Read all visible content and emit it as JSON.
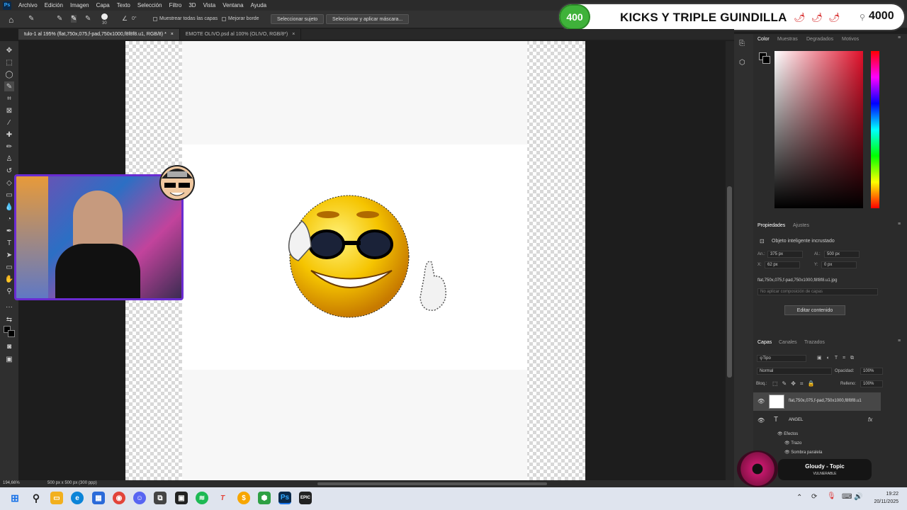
{
  "menu": [
    "Archivo",
    "Edición",
    "Imagen",
    "Capa",
    "Texto",
    "Selección",
    "Filtro",
    "3D",
    "Vista",
    "Ventana",
    "Ayuda"
  ],
  "options": {
    "brush_size": "30",
    "angle": "0°",
    "sample_all": "Muestrear todas las capas",
    "enhance_edge": "Mejorar borde",
    "select_subject": "Seleccionar sujeto",
    "select_mask": "Seleccionar y aplicar máscara..."
  },
  "tabs": [
    {
      "label": "tulo-1 al 195% (flat,750x,075,f-pad,750x1000,f8f8f8.u1, RGB/8) *",
      "close": "×"
    },
    {
      "label": "EMOTE OLIVO.psd al 100% (OLIVO, RGB/8*)",
      "close": "×"
    }
  ],
  "stream": {
    "left_count": "400",
    "title": "KICKS Y TRIPLE GUINDILLA",
    "right_count": "4000"
  },
  "color_panel": {
    "tabs": [
      "Color",
      "Muestras",
      "Degradados",
      "Motivos"
    ]
  },
  "properties": {
    "tabs": [
      "Propiedades",
      "Ajustes"
    ],
    "type": "Objeto inteligente incrustado",
    "w_label": "An.:",
    "w": "375 px",
    "h_label": "Al.:",
    "h": "500 px",
    "x_label": "X:",
    "x": "62 px",
    "y_label": "Y:",
    "y": "0 px",
    "filename": "flat,750x,075,f-pad,750x1000,f8f8f8.u1.jpg",
    "comp": "No aplicar composición de capas",
    "edit_button": "Editar contenido"
  },
  "layers": {
    "tabs": [
      "Capas",
      "Canales",
      "Trazados"
    ],
    "filter": "Tipo",
    "blend": "Normal",
    "opacity_label": "Opacidad:",
    "opacity": "100%",
    "lock_label": "Bloq.:",
    "fill_label": "Relleno:",
    "fill": "100%",
    "items": [
      {
        "name": "flat,750x,075,f-pad,750x1000,f8f8f8.u1"
      },
      {
        "name": "ANGEL",
        "fx": "fx"
      }
    ],
    "effects_label": "Efectos",
    "effects": [
      "Trazo",
      "Sombra paralela"
    ]
  },
  "music": {
    "title": "Gloudy - Topic",
    "subtitle": "VULNERABLE"
  },
  "status": {
    "zoom": "194,66%",
    "size": "500 px x 500 px (300 ppp)"
  },
  "clock": {
    "time": "19:22",
    "date": "20/11/2025"
  },
  "colors": {
    "accent": "#31a8ff",
    "stream_green": "#3fb23a",
    "webcam_border": "#6a2bd1"
  }
}
